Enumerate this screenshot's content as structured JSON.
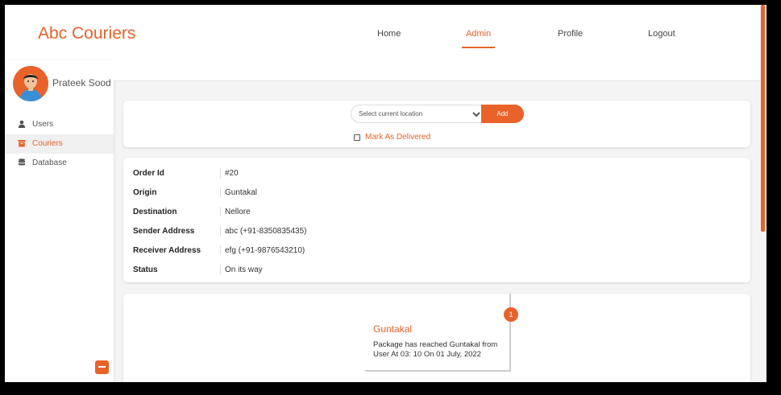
{
  "brand": "Abc Couriers",
  "nav": [
    {
      "label": "Home"
    },
    {
      "label": "Admin"
    },
    {
      "label": "Profile"
    },
    {
      "label": "Logout"
    }
  ],
  "user": {
    "name": "Prateek Sood"
  },
  "sidebar": {
    "items": [
      {
        "label": "Users",
        "icon": "user-icon"
      },
      {
        "label": "Couriers",
        "icon": "archive-icon"
      },
      {
        "label": "Database",
        "icon": "database-icon"
      }
    ]
  },
  "location_form": {
    "select_placeholder": "Select current location",
    "add_label": "Add",
    "mark_delivered_label": "Mark As Delivered"
  },
  "details": [
    {
      "key": "Order Id",
      "value": "#20"
    },
    {
      "key": "Origin",
      "value": "Guntakal"
    },
    {
      "key": "Destination",
      "value": "Nellore"
    },
    {
      "key": "Sender Address",
      "value": "abc (+91-8350835435)"
    },
    {
      "key": "Receiver Address",
      "value": "efg (+91-9876543210)"
    },
    {
      "key": "Status",
      "value": "On its way"
    }
  ],
  "timeline": [
    {
      "step": "1",
      "title": "Guntakal",
      "description": "Package has reached Guntakal from User At 03: 10 On 01 July, 2022"
    }
  ],
  "colors": {
    "accent": "#e8622a",
    "background": "#f4f4f4"
  }
}
